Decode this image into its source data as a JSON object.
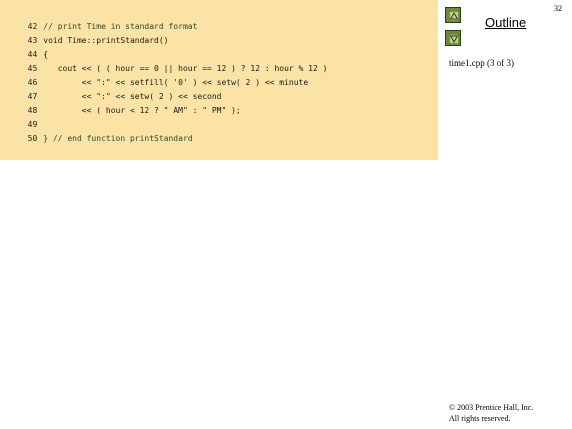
{
  "slide_number": "32",
  "nav": {
    "outline_label": "Outline",
    "file_label": "time1.cpp (3 of 3)"
  },
  "code": {
    "lines": [
      {
        "num": "42",
        "text": "// print Time in standard format"
      },
      {
        "num": "43",
        "text": "void Time::printStandard()"
      },
      {
        "num": "44",
        "text": "{"
      },
      {
        "num": "45",
        "text": "   cout << ( ( hour == 0 || hour == 12 ) ? 12 : hour % 12 )"
      },
      {
        "num": "46",
        "text": "        << \":\" << setfill( '0' ) << setw( 2 ) << minute"
      },
      {
        "num": "47",
        "text": "        << \":\" << setw( 2 ) << second"
      },
      {
        "num": "48",
        "text": "        << ( hour < 12 ? \" AM\" : \" PM\" );"
      },
      {
        "num": "49",
        "text": ""
      },
      {
        "num": "50",
        "text": "} // end function printStandard"
      }
    ]
  },
  "footer": {
    "copyright_line1": "© 2003 Prentice Hall, Inc.",
    "copyright_line2": "All rights reserved."
  },
  "colors": {
    "code_background": "#fbe3a6",
    "nav_button": "#6c8a3a",
    "number_literal": "#3b7fb8"
  }
}
